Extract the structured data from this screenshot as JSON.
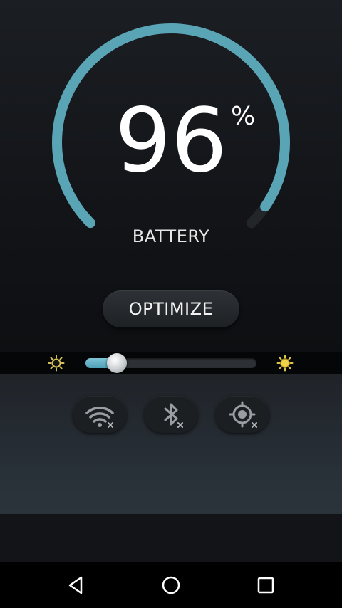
{
  "battery": {
    "level": 96,
    "percent_sign": "%",
    "label": "BATTERY",
    "arc_color": "#5aa5b5"
  },
  "actions": {
    "optimize_label": "OPTIMIZE"
  },
  "brightness": {
    "level_fraction": 0.14,
    "low_icon": "sun-dim-icon",
    "high_icon": "sun-bright-icon"
  },
  "toggles": [
    {
      "icon": "wifi-icon",
      "state": "off"
    },
    {
      "icon": "bluetooth-icon",
      "state": "off"
    },
    {
      "icon": "gps-icon",
      "state": "off"
    }
  ],
  "nav": {
    "back_icon": "back-icon",
    "home_icon": "home-icon",
    "recents_icon": "recents-icon"
  }
}
